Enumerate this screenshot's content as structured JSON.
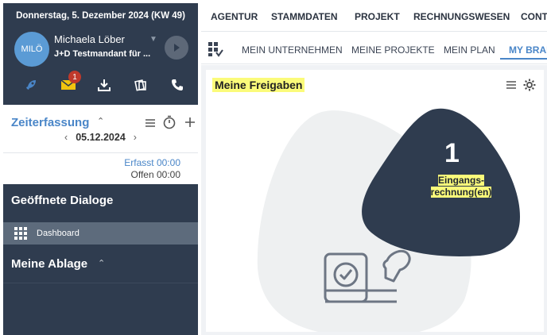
{
  "sidebar": {
    "date_line": "Donnerstag, 5. Dezember 2024 (KW 49)",
    "user": {
      "initials": "MILÖ",
      "name": "Michaela Löber",
      "tenant": "J+D Testmandant für ..."
    },
    "icons": [
      "rocket-icon",
      "mail-icon",
      "download-icon",
      "documents-icon",
      "phone-icon"
    ],
    "mail_badge": "1",
    "zeiterfassung": {
      "title": "Zeiterfassung",
      "date": "05.12.2024",
      "erfasst": "Erfasst 00:00",
      "offen": "Offen 00:00"
    },
    "geoeffnete_dialoge": {
      "title": "Geöffnete Dialoge",
      "items": [
        {
          "label": "Dashboard"
        }
      ]
    },
    "ablage": {
      "title": "Meine Ablage"
    }
  },
  "topnav": {
    "items": [
      "AGENTUR",
      "STAMMDATEN",
      "PROJEKT",
      "RECHNUNGSWESEN",
      "CONT"
    ]
  },
  "subnav": {
    "items": [
      "MEIN UNTERNEHMEN",
      "MEINE PROJEKTE",
      "MEIN PLAN",
      "MY BRAI"
    ],
    "active_index": 3
  },
  "widget": {
    "title": "Meine Freigaben",
    "count": "1",
    "count_label_line1": "Eingangs-",
    "count_label_line2": "rechnung(en)"
  },
  "colors": {
    "sidebar": "#2f3c4f",
    "accent": "#4a86c8",
    "highlight": "#fbfb7a",
    "blob_dark": "#2f3c4f",
    "blob_light": "#eef0f1"
  }
}
